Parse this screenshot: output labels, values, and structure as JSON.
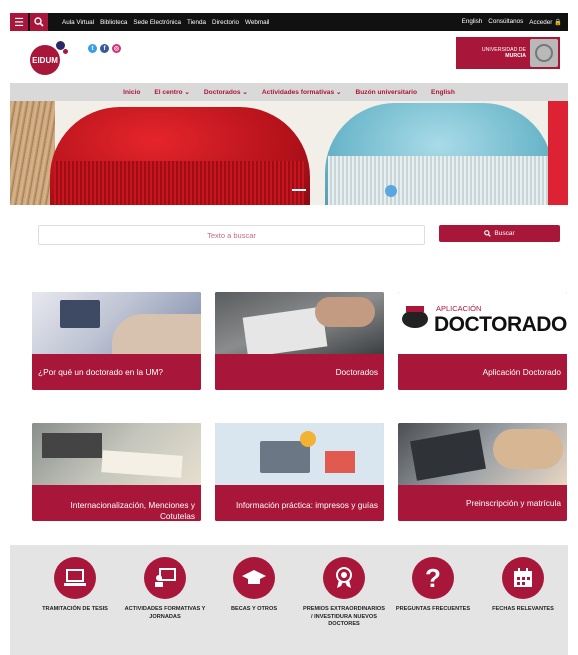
{
  "topbar": {
    "links": [
      "Aula Virtual",
      "Biblioteca",
      "Sede Electrónica",
      "Tienda",
      "Directorio",
      "Webmail"
    ],
    "right": [
      "English",
      "Consúltanos",
      "Acceder 🔒"
    ]
  },
  "header": {
    "logo_text": "EIDUM",
    "university": "UNIVERSIDAD DE",
    "university2": "MURCIA"
  },
  "nav": [
    "Inicio",
    "El centro ⌄",
    "Doctorados ⌄",
    "Actividades formativas ⌄",
    "Buzón universitario",
    "English"
  ],
  "search": {
    "placeholder": "Texto a buscar",
    "button": "Buscar"
  },
  "cards_row1": [
    {
      "label": "¿Por qué un doctorado en la UM?"
    },
    {
      "label": "Doctorados"
    },
    {
      "label": "Aplicación Doctorado"
    }
  ],
  "app_card": {
    "small": "APLICACIÓN",
    "big": "DOCTORADO"
  },
  "cards_row2": [
    {
      "label": "Internacionalización, Menciones y Cotutelas"
    },
    {
      "label": "Información práctica: impresos y guías"
    },
    {
      "label": "Preinscripción y matrícula"
    }
  ],
  "icons": [
    {
      "label": "TRAMITACIÓN DE TESIS",
      "icon": "laptop-icon"
    },
    {
      "label": "ACTIVIDADES FORMATIVAS Y JORNADAS",
      "icon": "presentation-icon"
    },
    {
      "label": "BECAS Y OTROS",
      "icon": "graduation-cap-icon"
    },
    {
      "label": "PREMIOS EXTRAORDINARIOS / INVESTIDURA NUEVOS DOCTORES",
      "icon": "award-icon"
    },
    {
      "label": "PREGUNTAS FRECUENTES",
      "icon": "question-icon"
    },
    {
      "label": "FECHAS RELEVANTES",
      "icon": "calendar-icon"
    }
  ],
  "colors": {
    "accent": "#a8173a",
    "topbar": "#111111",
    "nav_bg": "#d9d9d9",
    "band_bg": "#e4e4e4"
  }
}
